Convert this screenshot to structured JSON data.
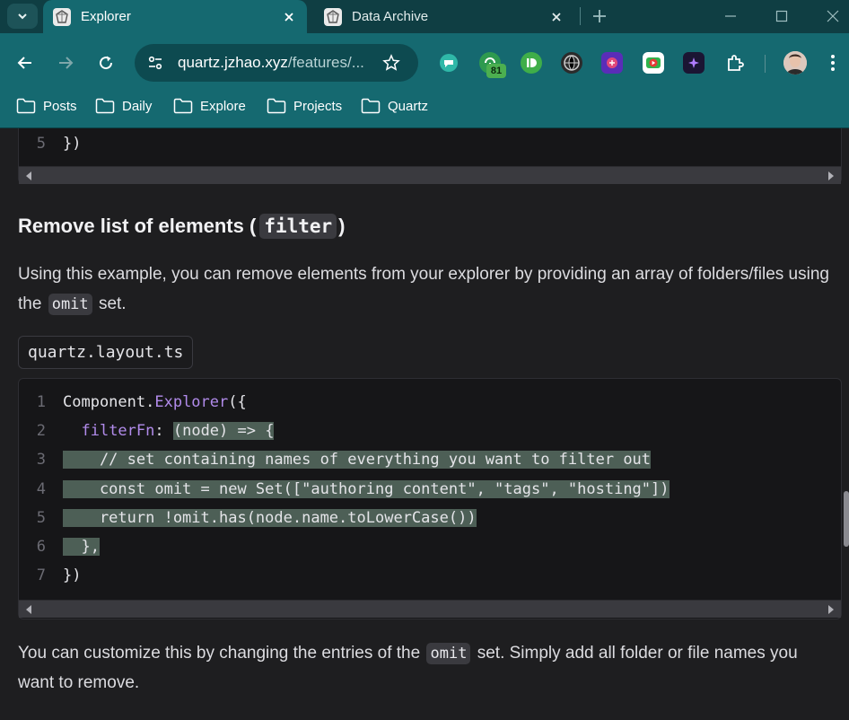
{
  "colors": {
    "frame": "#0f3e43",
    "toolbar": "#156970",
    "page_bg": "#1e1e20",
    "code_highlight": "#4d5f56",
    "keyword": "#b18bea"
  },
  "tabs": [
    {
      "title": "Explorer",
      "active": true,
      "icon": "quartz-favicon-icon"
    },
    {
      "title": "Data Archive",
      "active": false,
      "icon": "quartz-favicon-icon"
    }
  ],
  "omnibox": {
    "host": "quartz.jzhao.xyz",
    "path": "/features/..."
  },
  "extensions": {
    "badge_count": "81"
  },
  "bookmarks": [
    "Posts",
    "Daily",
    "Explore",
    "Projects",
    "Quartz"
  ],
  "top_code": {
    "line_number": "5",
    "text": "})"
  },
  "section": {
    "heading_prefix": "Remove list of elements (",
    "heading_code": "filter",
    "heading_suffix": ")",
    "intro_text_1": "Using this example, you can remove elements from your explorer by providing an array of folders/files using the",
    "intro_code": "omit",
    "intro_text_2": "set."
  },
  "code_file": {
    "name": "quartz.layout.ts"
  },
  "code_lines": [
    {
      "n": "1",
      "pre": "Component.",
      "kw": "Explorer",
      "post": "({",
      "hl": ""
    },
    {
      "n": "2",
      "pre": "  ",
      "kw": "filterFn",
      "post": ": ",
      "hl": "(node) => {"
    },
    {
      "n": "3",
      "pre": "",
      "kw": "",
      "post": "",
      "hl": "    // set containing names of everything you want to filter out"
    },
    {
      "n": "4",
      "pre": "",
      "kw": "",
      "post": "",
      "hl": "    const omit = new Set([\"authoring content\", \"tags\", \"hosting\"])"
    },
    {
      "n": "5",
      "pre": "",
      "kw": "",
      "post": "",
      "hl": "    return !omit.has(node.name.toLowerCase())"
    },
    {
      "n": "6",
      "pre": "",
      "kw": "",
      "post": "",
      "hl": "  },"
    },
    {
      "n": "7",
      "pre": "})",
      "kw": "",
      "post": "",
      "hl": ""
    }
  ],
  "outro": {
    "text_1": "You can customize this by changing the entries of the",
    "code": "omit",
    "text_2": "set. Simply add all folder or file names you want to remove."
  }
}
